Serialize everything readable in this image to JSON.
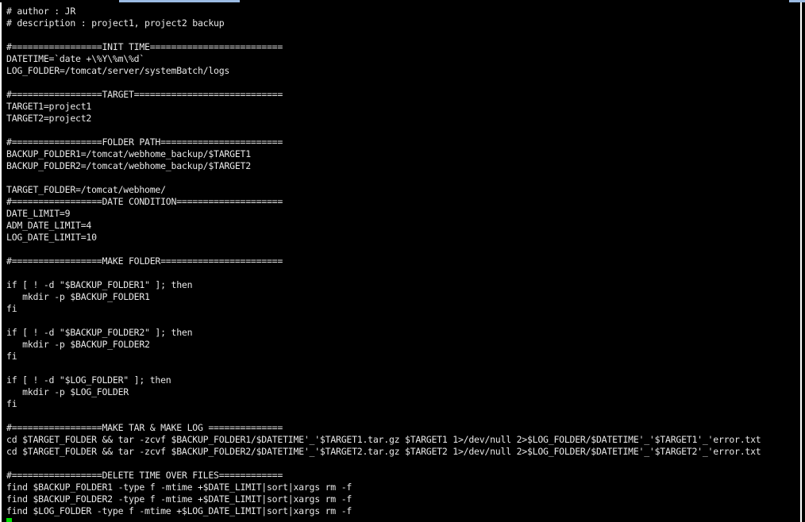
{
  "terminal": {
    "cursor_color": "#00e000",
    "background_color": "#000000",
    "text_color": "#e8e8e8",
    "lines": [
      "# author : JR",
      "# description : project1, project2 backup",
      "",
      "#=================INIT TIME=========================",
      "DATETIME=`date +\\%Y\\%m\\%d`",
      "LOG_FOLDER=/tomcat/server/systemBatch/logs",
      "",
      "#=================TARGET============================",
      "TARGET1=project1",
      "TARGET2=project2",
      "",
      "#=================FOLDER PATH=======================",
      "BACKUP_FOLDER1=/tomcat/webhome_backup/$TARGET1",
      "BACKUP_FOLDER2=/tomcat/webhome_backup/$TARGET2",
      "",
      "TARGET_FOLDER=/tomcat/webhome/",
      "#=================DATE CONDITION====================",
      "DATE_LIMIT=9",
      "ADM_DATE_LIMIT=4",
      "LOG_DATE_LIMIT=10",
      "",
      "#=================MAKE FOLDER=======================",
      "",
      "if [ ! -d \"$BACKUP_FOLDER1\" ]; then",
      "   mkdir -p $BACKUP_FOLDER1",
      "fi",
      "",
      "if [ ! -d \"$BACKUP_FOLDER2\" ]; then",
      "   mkdir -p $BACKUP_FOLDER2",
      "fi",
      "",
      "if [ ! -d \"$LOG_FOLDER\" ]; then",
      "   mkdir -p $LOG_FOLDER",
      "fi",
      "",
      "#=================MAKE TAR & MAKE LOG ==============",
      "cd $TARGET_FOLDER && tar -zcvf $BACKUP_FOLDER1/$DATETIME'_'$TARGET1.tar.gz $TARGET1 1>/dev/null 2>$LOG_FOLDER/$DATETIME'_'$TARGET1'_'error.txt",
      "cd $TARGET_FOLDER && tar -zcvf $BACKUP_FOLDER2/$DATETIME'_'$TARGET2.tar.gz $TARGET2 1>/dev/null 2>$LOG_FOLDER/$DATETIME'_'$TARGET2'_'error.txt",
      "",
      "#=================DELETE TIME OVER FILES============",
      "find $BACKUP_FOLDER1 -type f -mtime +$DATE_LIMIT|sort|xargs rm -f",
      "find $BACKUP_FOLDER2 -type f -mtime +$DATE_LIMIT|sort|xargs rm -f",
      "find $LOG_FOLDER -type f -mtime +$LOG_DATE_LIMIT|sort|xargs rm -f"
    ]
  }
}
